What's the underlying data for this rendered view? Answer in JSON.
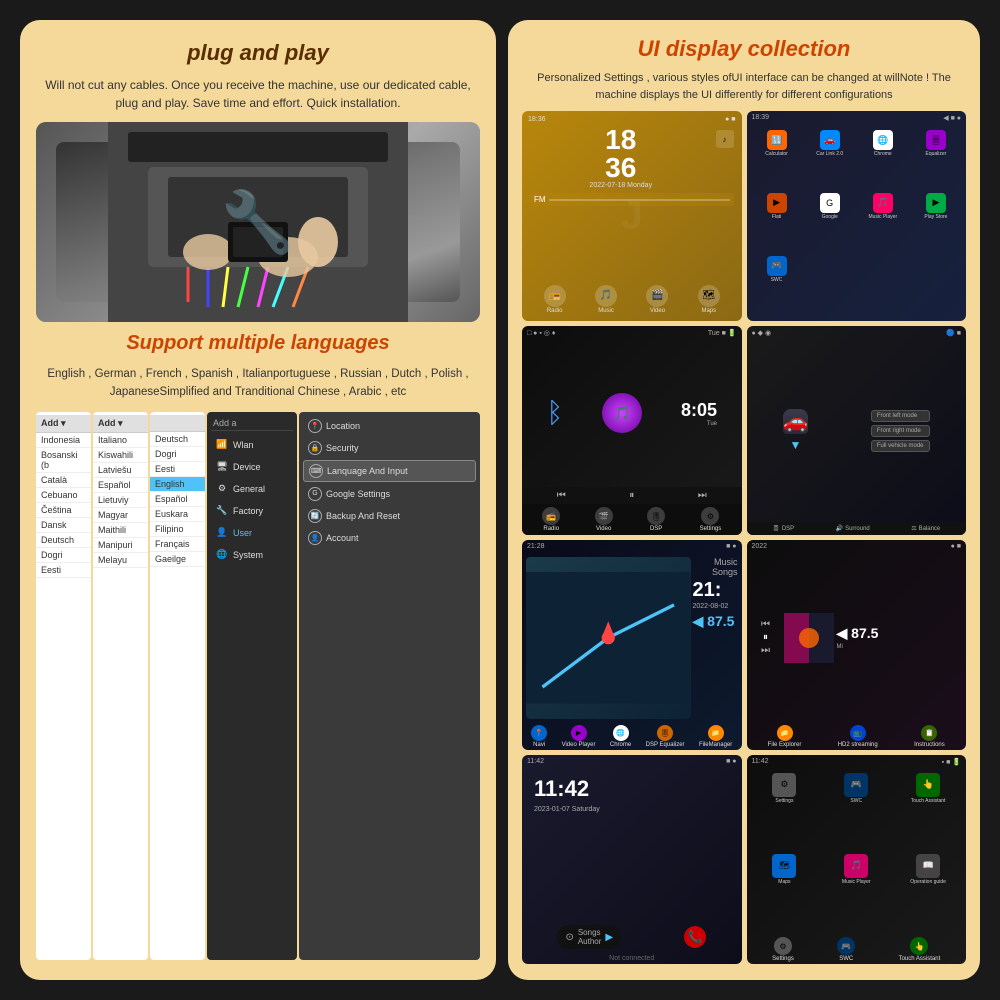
{
  "left_panel": {
    "plug_title": "plug and play",
    "plug_desc": "Will not cut any cables. Once you receive the machine,\nuse our dedicated cable, plug and play.\nSave time and effort. Quick installation.",
    "lang_title": "Support multiple languages",
    "lang_desc": "English , German , French , Spanish , Italianportuguese ,\nRussian , Dutch , Polish , JapaneseSimplified and\nTranditional Chinese , Arabic , etc",
    "settings_menu": {
      "header": "Add a",
      "items": [
        {
          "icon": "📶",
          "label": "Wlan"
        },
        {
          "icon": "📱",
          "label": "Device"
        },
        {
          "icon": "⚙️",
          "label": "General"
        },
        {
          "icon": "🔧",
          "label": "Factory"
        },
        {
          "icon": "👤",
          "label": "User",
          "active": true
        },
        {
          "icon": "🌐",
          "label": "System"
        }
      ]
    },
    "submenu_items": [
      {
        "icon": "📍",
        "label": "Location"
      },
      {
        "icon": "🔒",
        "label": "Security"
      },
      {
        "icon": "⌨️",
        "label": "Lanquage And Input",
        "active": true
      },
      {
        "icon": "G",
        "label": "Google Settings"
      },
      {
        "icon": "🔄",
        "label": "Backup And Reset"
      },
      {
        "icon": "👤",
        "label": "Account"
      }
    ],
    "language_list": [
      "Indonesia",
      "Italiano",
      "Bosanski (b",
      "Kiswahili",
      "Català",
      "Latviešu",
      "Cebuano",
      "Español",
      "Čeština",
      "Lietuviy",
      "Dansk",
      "Magyar",
      "Deutsch",
      "Maithili",
      "Dogri",
      "Manipuri",
      "Eesti",
      "Melayu"
    ],
    "lang_col2": [
      "Deutsch",
      "Dogri",
      "Eesti",
      "English",
      "Español",
      "Euskara",
      "Filipino",
      "Français",
      "Gaeilge"
    ]
  },
  "right_panel": {
    "ui_title": "UI display collection",
    "ui_desc": "Personalized Settings , various styles ofUI interface can be\nchanged at willNote !\nThe machine displays the UI differently for different\nconfigurations",
    "cells": [
      {
        "id": 1,
        "time": "18 36",
        "date": "2022-07-18  Monday",
        "status": "18:36 ● ■",
        "icons": [
          "Radio",
          "Music",
          "Video",
          "Maps"
        ]
      },
      {
        "id": 2,
        "status": "18:39 ◀ ■",
        "apps": [
          "Calculator",
          "Car Link 2.0",
          "Chrome",
          "Equalizer",
          "Flati",
          "Google",
          "Music Player",
          "Play Store",
          "SWC"
        ]
      },
      {
        "id": 3,
        "has_bluetooth": true,
        "time": "8:05",
        "icons": [
          "Radio",
          "Video",
          "DSP",
          "Settings"
        ]
      },
      {
        "id": 4,
        "modes": [
          "Front left mode",
          "Front right mode",
          "Full vehicle mode"
        ],
        "bottom": [
          "DSP",
          "Surround",
          "Balance"
        ]
      },
      {
        "id": 5,
        "time": "21:",
        "date": "2022-08-02",
        "speed": "87.5",
        "icons": [
          "Navi",
          "Video Player",
          "Chrome",
          "DSP Equalizer",
          "FileManager",
          "File Explorer",
          "HD2 streaming",
          "Instructions",
          "Ma"
        ]
      },
      {
        "id": 6,
        "time": "21:28",
        "music_label": "Music\nSongs",
        "speed": "87.5"
      },
      {
        "id": 7,
        "clock": "11:42",
        "date": "2023-01-07  Saturday",
        "bottom_icons": [
          "Songs Author",
          "Phone"
        ]
      },
      {
        "id": 8,
        "clock": "11:42",
        "apps": [
          "Settings",
          "SWC",
          "Touch Assistant"
        ]
      }
    ]
  }
}
